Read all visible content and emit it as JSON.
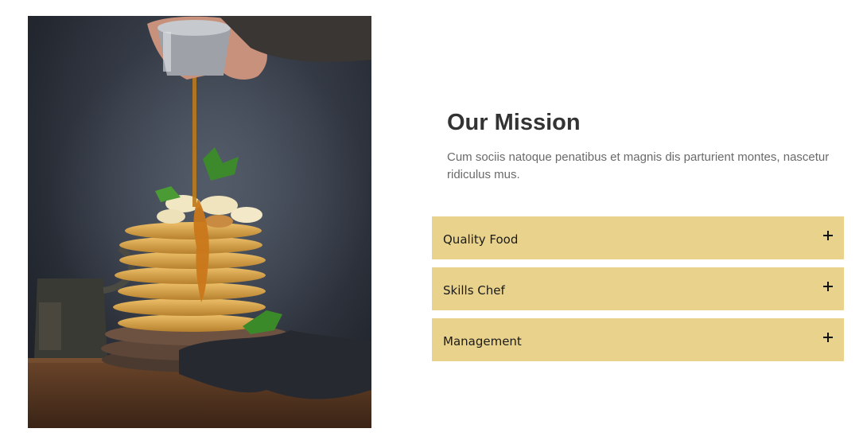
{
  "image": {
    "subject": "pancake-stack-with-syrup-photo",
    "colors": {
      "background_dark": "#2b3039",
      "pancake": "#dca94f",
      "syrup": "#c9781a",
      "wood": "#5a3a22"
    }
  },
  "mission": {
    "title": "Our Mission",
    "description": "Cum sociis natoque penatibus et magnis dis parturient montes, nascetur ridiculus mus."
  },
  "accordion": {
    "accent_color": "#e9d38c",
    "items": [
      {
        "label": "Quality Food",
        "icon": "plus-icon",
        "expanded": false
      },
      {
        "label": "Skills Chef",
        "icon": "plus-icon",
        "expanded": false
      },
      {
        "label": "Management",
        "icon": "plus-icon",
        "expanded": false
      }
    ]
  }
}
